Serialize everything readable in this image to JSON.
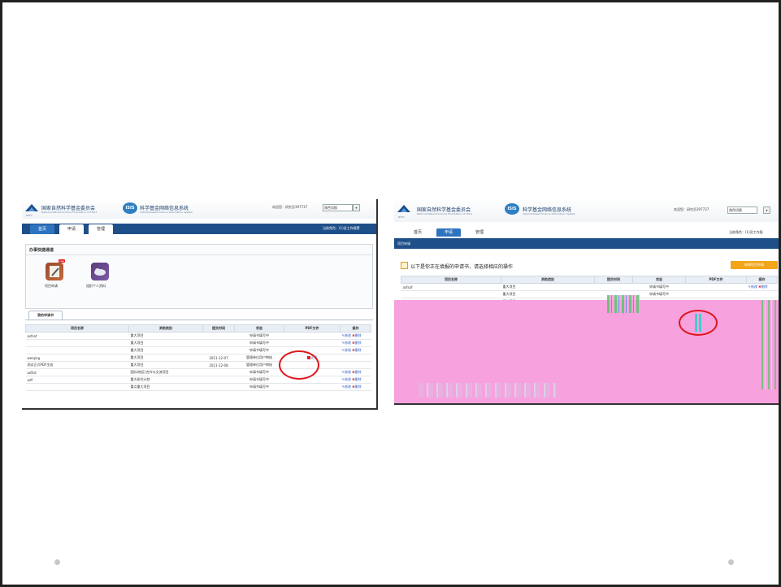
{
  "left_shot": {
    "org_name": "国家自然科学基金委员会",
    "org_sub": "National Natural Science Foundation of China",
    "nsfc_mark": "NSFC",
    "system_logo": "ISIS",
    "system_name": "科学基金网络信息系统",
    "system_sub": "Internet-based Science Information System",
    "welcome": "欢迎您：研究员397737",
    "role_select": "角色切换",
    "tabs": [
      "首页",
      "申请",
      "管理"
    ],
    "location": "当前角色：(1)员工作报警",
    "quick_panel_title": "办事快捷通道",
    "apps": [
      {
        "label": "项目申请",
        "icon": "pencil-notepad-icon",
        "badge": "new"
      },
      {
        "label": "组织个人资料",
        "icon": "cloud-hand-icon"
      }
    ],
    "my_tab": "我的申请书",
    "columns": [
      "项目名称",
      "资助类别",
      "提交时间",
      "状态",
      "PDF文件",
      "操作"
    ],
    "rows": [
      {
        "name": "asfsaf",
        "type": "重大项目",
        "time": "",
        "status": "申请书填写中",
        "pdf": "",
        "op_edit": "修改",
        "op_del": "删除"
      },
      {
        "name": "",
        "type": "重大项目",
        "time": "",
        "status": "申请书填写中",
        "pdf": "",
        "op_edit": "修改",
        "op_del": "删除"
      },
      {
        "name": "",
        "type": "重大项目",
        "time": "",
        "status": "申请书填写中",
        "pdf": "",
        "op_edit": "修改",
        "op_del": "删除"
      },
      {
        "name": "weiqing",
        "type": "重大项目",
        "time": "2011-12-07",
        "status": "管理单位用户审核",
        "pdf": "正式",
        "op_edit": "",
        "op_del": ""
      },
      {
        "name": "测试正式PDF生成",
        "type": "重大项目",
        "time": "2011-12-08",
        "status": "管理单位用户审核",
        "pdf": "",
        "op_edit": "",
        "op_del": ""
      },
      {
        "name": "adfsd",
        "type": "国际(地区)合作与交流项目",
        "time": "",
        "status": "申请书填写中",
        "pdf": "",
        "op_edit": "修改",
        "op_del": "删除"
      },
      {
        "name": "adf",
        "type": "重大研究计划",
        "time": "",
        "status": "申请书填写中",
        "pdf": "",
        "op_edit": "修改",
        "op_del": "删除"
      },
      {
        "name": "",
        "type": "重点重大项目",
        "time": "",
        "status": "申请书填写中",
        "pdf": "",
        "op_edit": "修改",
        "op_del": "删除"
      }
    ]
  },
  "right_shot": {
    "org_name": "国家自然科学基金委员会",
    "org_sub": "National Natural Science Foundation of China",
    "nsfc_mark": "NSFC",
    "system_logo": "ISIS",
    "system_name": "科学基金网络信息系统",
    "system_sub": "Internet-based Science Information System",
    "welcome": "欢迎您：研究员397737",
    "role_select": "角色切换",
    "tabs": [
      "首页",
      "申请",
      "管理"
    ],
    "location": "当前角色：(1)员工作报",
    "section_title": "项目申请",
    "hint": "以下是你正在填报的申请书，请选择相应的操作",
    "new_button": "新增项目申请",
    "columns": [
      "项目名称",
      "资助类别",
      "提交时间",
      "状态",
      "PDF文件",
      "操作"
    ],
    "rows": [
      {
        "name": "asfsaf",
        "type": "重大项目",
        "status": "申请书填写中",
        "op_edit": "修改",
        "op_del": "删除"
      },
      {
        "name": "",
        "type": "重大项目",
        "status": "申请书填写中",
        "op_edit": "",
        "op_del": ""
      },
      {
        "name": "",
        "type": "重大项目",
        "status": "",
        "op_edit": "",
        "op_del": ""
      }
    ]
  },
  "colors": {
    "annotation_ring": "#e0171b",
    "nav": "#1e4f88",
    "active_tab": "#2d74c0",
    "glitch_magenta": "#f7a1df"
  }
}
